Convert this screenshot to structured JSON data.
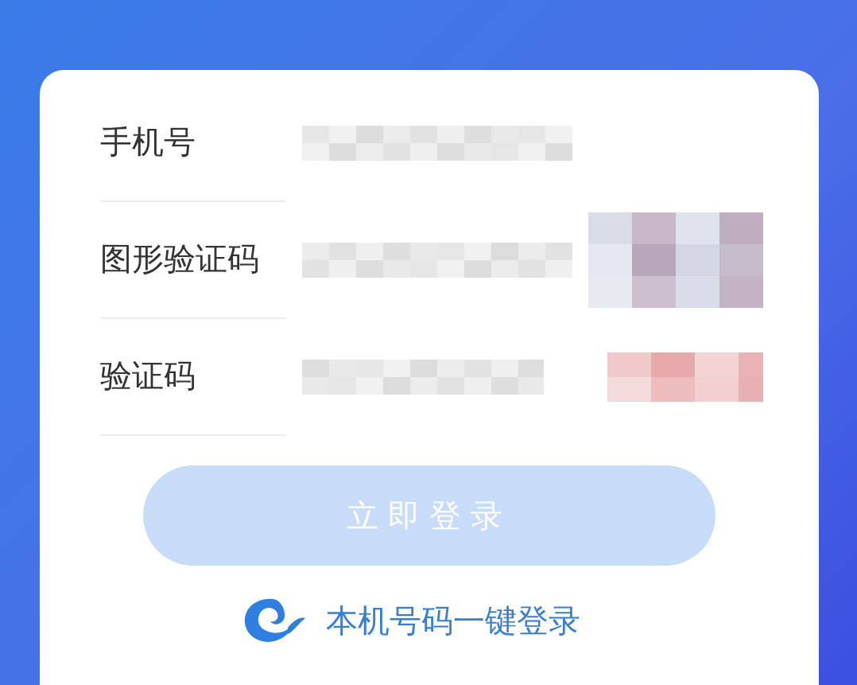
{
  "form": {
    "fields": [
      {
        "kind": "text",
        "label": "手机号"
      },
      {
        "kind": "captcha",
        "label": "图形验证码"
      },
      {
        "kind": "sms",
        "label": "验证码"
      }
    ]
  },
  "login_button": {
    "label": "立即登录",
    "disabled": true
  },
  "quick_login": {
    "label": "本机号码一键登录"
  }
}
